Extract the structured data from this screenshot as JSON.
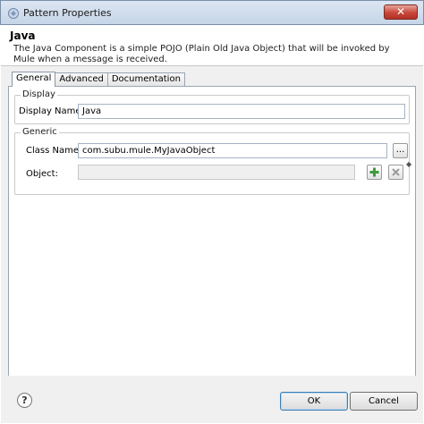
{
  "window": {
    "title": "Pattern Properties",
    "close_label": "✕"
  },
  "header": {
    "title": "Java",
    "description": "The Java Component is a simple POJO (Plain Old Java Object) that will be invoked by Mule when a message is received."
  },
  "tabs": [
    {
      "label": "General",
      "active": true
    },
    {
      "label": "Advanced",
      "active": false
    },
    {
      "label": "Documentation",
      "active": false
    }
  ],
  "display": {
    "group_label": "Display",
    "name_label": "Display Name:",
    "name_value": "Java"
  },
  "generic": {
    "group_label": "Generic",
    "class_label": "Class Name:",
    "class_value": "com.subu.mule.MyJavaObject",
    "browse_label": "...",
    "object_label": "Object:",
    "object_value": ""
  },
  "footer": {
    "help_label": "?",
    "ok_label": "OK",
    "cancel_label": "Cancel"
  },
  "colors": {
    "add_green": "#3f9a3a",
    "delete_gray": "#9a9a9a",
    "title_bar": "#c6d5e8"
  }
}
